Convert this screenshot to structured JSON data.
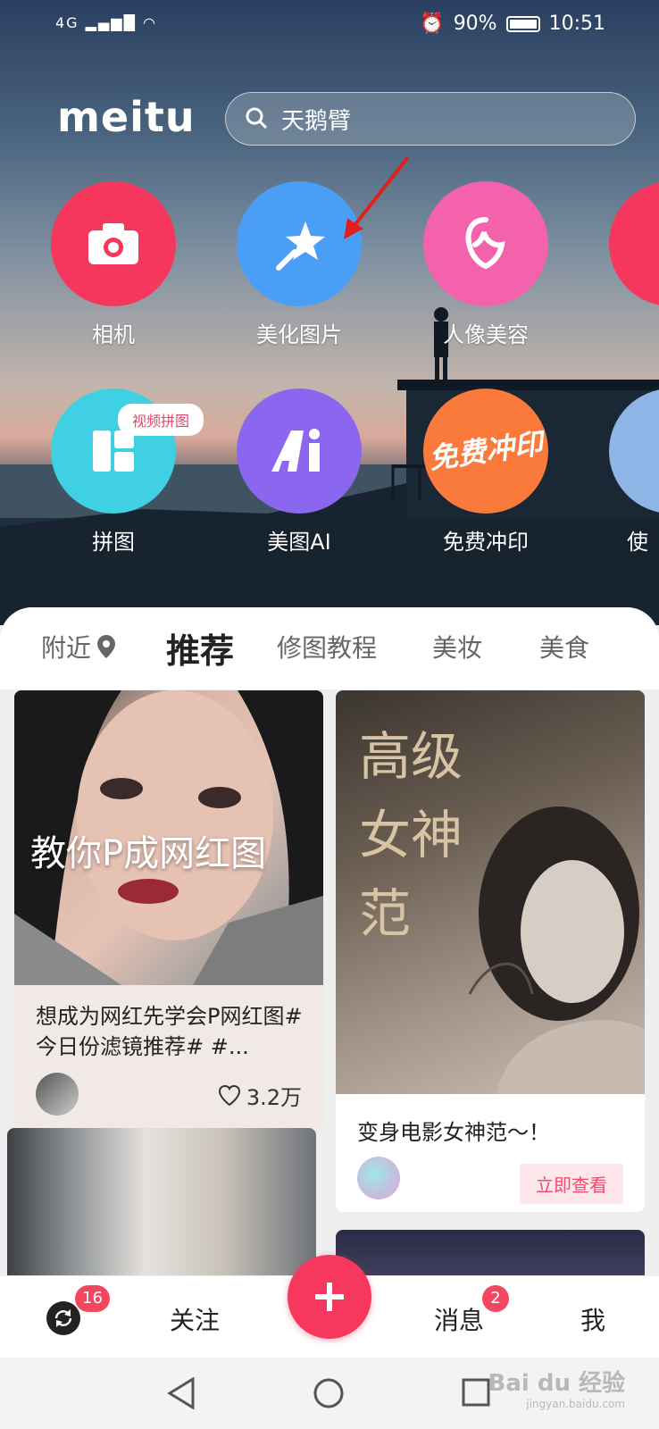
{
  "status_bar": {
    "network": "4G",
    "battery": "90%",
    "time": "10:51"
  },
  "header": {
    "logo": "meitu",
    "search_placeholder": "天鹅臂"
  },
  "tools": [
    {
      "label": "相机",
      "icon": "camera-icon",
      "color": "#f5375d"
    },
    {
      "label": "美化图片",
      "icon": "magic-wand-icon",
      "color": "#4b9ef6"
    },
    {
      "label": "人像美容",
      "icon": "face-outline-icon",
      "color": "#f462ab"
    },
    {
      "label": "拼图",
      "icon": "collage-icon",
      "color": "#3fd0e3",
      "badge": "视频拼图"
    },
    {
      "label": "美图AI",
      "icon": "ai-icon",
      "color": "#8b67f0"
    },
    {
      "label": "免费冲印",
      "icon": "free-print-icon",
      "color": "#fa7a3c",
      "overlay_text": "免费冲印"
    },
    {
      "label": "使",
      "icon": "partial-tool-icon"
    }
  ],
  "tabs": [
    {
      "label": "附近",
      "icon": "location-pin-icon"
    },
    {
      "label": "推荐",
      "active": true
    },
    {
      "label": "修图教程"
    },
    {
      "label": "美妆"
    },
    {
      "label": "美食"
    }
  ],
  "feed": [
    {
      "overlay_text": "教你P成网红图",
      "title": "想成为网红先学会P网红图#今日份滤镜推荐# #...",
      "likes": "3.2万"
    },
    {
      "overlay_text": "高级女神范",
      "title": "变身电影女神范～！",
      "action": "立即查看"
    }
  ],
  "tab_bar": {
    "refresh_badge": "16",
    "follow_label": "关注",
    "messages_label": "消息",
    "messages_badge": "2",
    "me_label": "我"
  },
  "watermark": {
    "brand": "Bai du 经验",
    "url": "jingyan.baidu.com"
  }
}
